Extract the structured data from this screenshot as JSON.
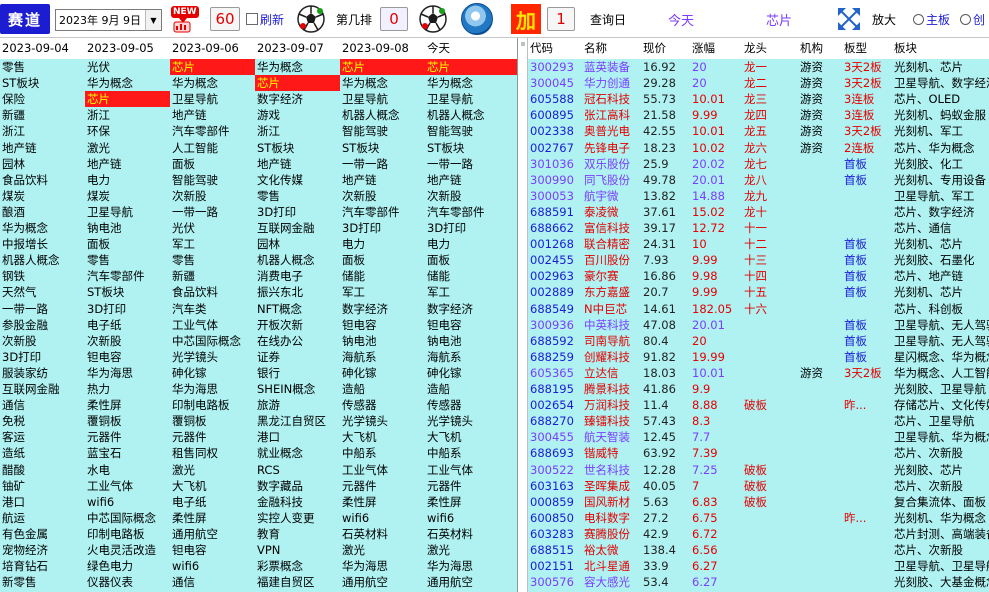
{
  "toolbar": {
    "saidao": "赛道",
    "date": "2023年 9月 9日",
    "new_badge": "NEW",
    "count_left": "60",
    "refresh_label": "刷新",
    "rank_label": "第几排",
    "rank_value": "0",
    "jia": "加",
    "jia_value": "1",
    "query_day": "查询日",
    "today_tab": "今天",
    "chip_tab": "芯片",
    "zoom_label": "放大",
    "radio_main": "主板",
    "radio_chuang": "创",
    "accent_red": "#ff1818",
    "accent_blue": "#1c1cd0",
    "icons": [
      "calendar-dropdown-icon",
      "hot-stock-icon",
      "soccer-ball-icon",
      "globe-icon",
      "expand-icon"
    ]
  },
  "left_table": {
    "columns": [
      "2023-09-04",
      "2023-09-05",
      "2023-09-06",
      "2023-09-07",
      "2023-09-08",
      "今天"
    ],
    "rows": [
      [
        "零售",
        "光伏",
        "芯片",
        "华为概念",
        "芯片",
        "芯片"
      ],
      [
        "ST板块",
        "华为概念",
        "华为概念",
        "芯片",
        "华为概念",
        "华为概念"
      ],
      [
        "保险",
        "芯片",
        "卫星导航",
        "数字经济",
        "卫星导航",
        "卫星导航"
      ],
      [
        "新疆",
        "浙江",
        "地产链",
        "游戏",
        "机器人概念",
        "机器人概念"
      ],
      [
        "浙江",
        "环保",
        "汽车零部件",
        "浙江",
        "智能驾驶",
        "智能驾驶"
      ],
      [
        "地产链",
        "激光",
        "人工智能",
        "ST板块",
        "ST板块",
        "ST板块"
      ],
      [
        "园林",
        "地产链",
        "面板",
        "地产链",
        "一带一路",
        "一带一路"
      ],
      [
        "食品饮料",
        "电力",
        "智能驾驶",
        "文化传媒",
        "地产链",
        "地产链"
      ],
      [
        "煤炭",
        "煤炭",
        "次新股",
        "零售",
        "次新股",
        "次新股"
      ],
      [
        "酿酒",
        "卫星导航",
        "一带一路",
        "3D打印",
        "汽车零部件",
        "汽车零部件"
      ],
      [
        "华为概念",
        "钠电池",
        "光伏",
        "互联网金融",
        "3D打印",
        "3D打印"
      ],
      [
        "中报增长",
        "面板",
        "军工",
        "园林",
        "电力",
        "电力"
      ],
      [
        "机器人概念",
        "零售",
        "零售",
        "机器人概念",
        "面板",
        "面板"
      ],
      [
        "钢铁",
        "汽车零部件",
        "新疆",
        "消费电子",
        "储能",
        "储能"
      ],
      [
        "天然气",
        "ST板块",
        "食品饮料",
        "振兴东北",
        "军工",
        "军工"
      ],
      [
        "一带一路",
        "3D打印",
        "汽车类",
        "NFT概念",
        "数字经济",
        "数字经济"
      ],
      [
        "参股金融",
        "电子纸",
        "工业气体",
        "开板次新",
        "钽电容",
        "钽电容"
      ],
      [
        "次新股",
        "次新股",
        "中芯国际概念",
        "在线办公",
        "钠电池",
        "钠电池"
      ],
      [
        "3D打印",
        "钽电容",
        "光学镜头",
        "证券",
        "海航系",
        "海航系"
      ],
      [
        "服装家纺",
        "华为海思",
        "砷化镓",
        "银行",
        "砷化镓",
        "砷化镓"
      ],
      [
        "互联网金融",
        "热力",
        "华为海思",
        "SHEIN概念",
        "造船",
        "造船"
      ],
      [
        "通信",
        "柔性屏",
        "印制电路板",
        "旅游",
        "传感器",
        "传感器"
      ],
      [
        "免税",
        "覆铜板",
        "覆铜板",
        "黑龙江自贸区",
        "光学镜头",
        "光学镜头"
      ],
      [
        "客运",
        "元器件",
        "元器件",
        "港口",
        "大飞机",
        "大飞机"
      ],
      [
        "造纸",
        "蓝宝石",
        "租售同权",
        "就业概念",
        "中船系",
        "中船系"
      ],
      [
        "醋酸",
        "水电",
        "激光",
        "RCS",
        "工业气体",
        "工业气体"
      ],
      [
        "铀矿",
        "工业气体",
        "大飞机",
        "数字藏品",
        "元器件",
        "元器件"
      ],
      [
        "港口",
        "wifi6",
        "电子纸",
        "金融科技",
        "柔性屏",
        "柔性屏"
      ],
      [
        "航运",
        "中芯国际概念",
        "柔性屏",
        "实控人变更",
        "wifi6",
        "wifi6"
      ],
      [
        "有色金属",
        "印制电路板",
        "通用航空",
        "教育",
        "石英材料",
        "石英材料"
      ],
      [
        "宠物经济",
        "火电灵活改造",
        "钽电容",
        "VPN",
        "激光",
        "激光"
      ],
      [
        "培育钻石",
        "绿色电力",
        "wifi6",
        "彩票概念",
        "华为海思",
        "华为海思"
      ],
      [
        "新零售",
        "仪器仪表",
        "通信",
        "福建自贸区",
        "通用航空",
        "通用航空"
      ]
    ],
    "highlight": [
      [
        0,
        2
      ],
      [
        0,
        4
      ],
      [
        0,
        5
      ],
      [
        1,
        3
      ],
      [
        2,
        1
      ]
    ]
  },
  "right_table": {
    "columns": [
      "代码",
      "名称",
      "现价",
      "涨幅",
      "龙头",
      "机构",
      "板型",
      "板块"
    ],
    "rows": [
      [
        "300293",
        "蓝英装备",
        "16.92",
        "20",
        "龙一",
        "游资",
        "3天2板",
        "光刻机、芯片"
      ],
      [
        "300045",
        "华力创通",
        "29.28",
        "20",
        "龙二",
        "游资",
        "3天2板",
        "卫星导航、数字经济"
      ],
      [
        "605588",
        "冠石科技",
        "55.73",
        "10.01",
        "龙三",
        "游资",
        "3连板",
        "芯片、OLED"
      ],
      [
        "600895",
        "张江高科",
        "21.58",
        "9.99",
        "龙四",
        "游资",
        "3连板",
        "光刻机、蚂蚁金服"
      ],
      [
        "002338",
        "奥普光电",
        "42.55",
        "10.01",
        "龙五",
        "游资",
        "3天2板",
        "光刻机、军工"
      ],
      [
        "002767",
        "先锋电子",
        "18.23",
        "10.02",
        "龙六",
        "游资",
        "2连板",
        "芯片、华为概念"
      ],
      [
        "301036",
        "双乐股份",
        "25.9",
        "20.02",
        "龙七",
        "",
        "首板",
        "光刻胶、化工"
      ],
      [
        "300990",
        "同飞股份",
        "49.78",
        "20.01",
        "龙八",
        "",
        "首板",
        "光刻机、专用设备"
      ],
      [
        "300053",
        "航宇微",
        "13.82",
        "14.88",
        "龙九",
        "",
        "",
        "卫星导航、军工"
      ],
      [
        "688591",
        "泰凌微",
        "37.61",
        "15.02",
        "龙十",
        "",
        "",
        "芯片、数字经济"
      ],
      [
        "688662",
        "富信科技",
        "39.17",
        "12.72",
        "十一",
        "",
        "",
        "芯片、通信"
      ],
      [
        "001268",
        "联合精密",
        "24.31",
        "10",
        "十二",
        "",
        "首板",
        "光刻机、芯片"
      ],
      [
        "002455",
        "百川股份",
        "7.93",
        "9.99",
        "十三",
        "",
        "首板",
        "光刻胶、石墨化"
      ],
      [
        "002963",
        "豪尔赛",
        "16.86",
        "9.98",
        "十四",
        "",
        "首板",
        "芯片、地产链"
      ],
      [
        "002889",
        "东方嘉盛",
        "20.7",
        "9.99",
        "十五",
        "",
        "首板",
        "光刻机、芯片"
      ],
      [
        "688549",
        "N中巨芯",
        "14.61",
        "182.05",
        "十六",
        "",
        "",
        "芯片、科创板"
      ],
      [
        "300936",
        "中英科技",
        "47.08",
        "20.01",
        "",
        "",
        "首板",
        "卫星导航、无人驾驶"
      ],
      [
        "688592",
        "司南导航",
        "80.4",
        "20",
        "",
        "",
        "首板",
        "卫星导航、无人驾驶"
      ],
      [
        "688259",
        "创耀科技",
        "91.82",
        "19.99",
        "",
        "",
        "首板",
        "星闪概念、华为概念"
      ],
      [
        "605365",
        "立达信",
        "18.03",
        "10.01",
        "",
        "游资",
        "3天2板",
        "华为概念、人工智能"
      ],
      [
        "688195",
        "腾景科技",
        "41.86",
        "9.9",
        "",
        "",
        "",
        "光刻胶、卫星导航"
      ],
      [
        "002654",
        "万润科技",
        "11.4",
        "8.88",
        "破板",
        "",
        "昨...",
        "存储芯片、文化传媒"
      ],
      [
        "688270",
        "臻镭科技",
        "57.43",
        "8.3",
        "",
        "",
        "",
        "芯片、卫星导航"
      ],
      [
        "300455",
        "航天智装",
        "12.45",
        "7.7",
        "",
        "",
        "",
        "卫星导航、华为概念"
      ],
      [
        "688693",
        "锴威特",
        "63.92",
        "7.39",
        "",
        "",
        "",
        "芯片、次新股"
      ],
      [
        "300522",
        "世名科技",
        "12.28",
        "7.25",
        "破板",
        "",
        "",
        "光刻胶、芯片"
      ],
      [
        "603163",
        "圣晖集成",
        "40.05",
        "7",
        "破板",
        "",
        "",
        "芯片、次新股"
      ],
      [
        "000859",
        "国风新材",
        "5.63",
        "6.83",
        "破板",
        "",
        "",
        "复合集流体、面板"
      ],
      [
        "600850",
        "电科数字",
        "27.2",
        "6.75",
        "",
        "",
        "昨...",
        "光刻机、华为概念"
      ],
      [
        "603283",
        "赛腾股份",
        "42.9",
        "6.72",
        "",
        "",
        "",
        "芯片封测、高端装备"
      ],
      [
        "688515",
        "裕太微",
        "138.4",
        "6.56",
        "",
        "",
        "",
        "芯片、次新股"
      ],
      [
        "002151",
        "北斗星通",
        "33.9",
        "6.27",
        "",
        "",
        "",
        "卫星导航、卫星导航"
      ],
      [
        "300576",
        "容大感光",
        "53.4",
        "6.27",
        "",
        "",
        "",
        "光刻胶、大基金概念"
      ]
    ],
    "purple_codes": [
      0,
      1,
      6,
      7,
      8,
      16,
      19,
      23,
      25,
      32
    ],
    "purple_names": [
      0,
      1,
      6,
      7,
      8,
      16,
      23,
      25,
      32
    ]
  }
}
